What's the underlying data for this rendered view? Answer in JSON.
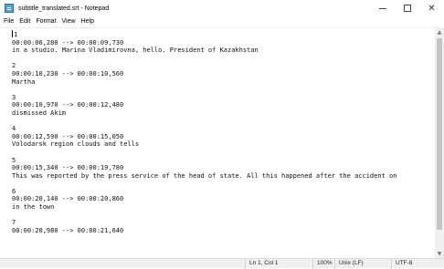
{
  "window": {
    "title": "subtitle_translated.srt - Notepad",
    "controls": {
      "minimize": "—",
      "maximize": "☐",
      "close": "✕"
    }
  },
  "menu": {
    "file": "File",
    "edit": "Edit",
    "format": "Format",
    "view": "View",
    "help": "Help"
  },
  "editor": {
    "lines": [
      "1",
      "00:00:06,280 --> 00:00:09,730",
      "in a studio. Marina Vladimirovna, hello. President of Kazakhstan",
      "",
      "2",
      "00:00:10,230 --> 00:00:10,560",
      "Martha",
      "",
      "3",
      "00:00:10,970 --> 00:00:12,480",
      "dismissed Akim",
      "",
      "4",
      "00:00:12,590 --> 00:00:15,050",
      "Volodarsk region clouds and tells",
      "",
      "5",
      "00:00:15,340 --> 00:00:19,780",
      "This was reported by the press service of the head of state. All this happened after the accident on",
      "",
      "6",
      "00:00:20,140 --> 00:00:20,860",
      "in the town",
      "",
      "7",
      "00:00:20,980 --> 00:00:21,640"
    ]
  },
  "status": {
    "position": "Ln 1, Col 1",
    "zoom": "100%",
    "line_endings": "Unix (LF)",
    "encoding": "UTF-8"
  }
}
